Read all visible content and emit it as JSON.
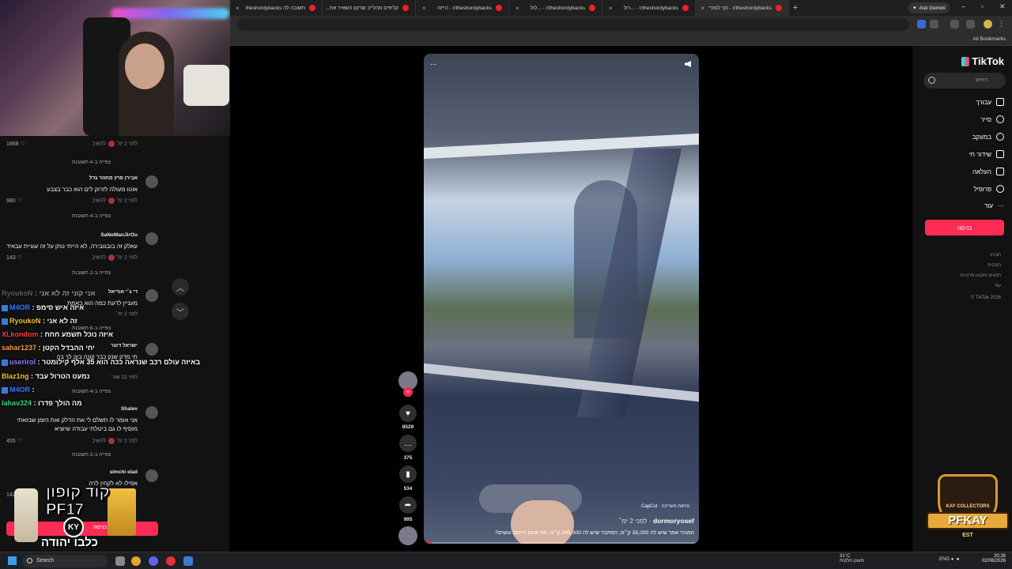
{
  "browser": {
    "tabs": [
      {
        "label": "תשובה לה theshordybacks"
      },
      {
        "label": "קליפים מהלייב שרקון השאיר את..."
      },
      {
        "label": "r/theshordybacks - הייזה"
      },
      {
        "label": "r/theshordybacks - ...לול"
      },
      {
        "label": "r/theshordybacks - ...רול"
      },
      {
        "label": "r/theshordybacks - נקי לנוזרי"
      }
    ],
    "new_tab": "+",
    "gemini_label": "Ask Gemini",
    "bookmarks_label": "All Bookmarks"
  },
  "comments": [
    {
      "author": "",
      "text": "",
      "meta": "לפני 2 ימ׳",
      "reply": "להשיב",
      "likes": "1868",
      "replies": "צפייה ב-4 תשובות"
    },
    {
      "author": "אבירן פרץ מחוזר גדל",
      "text": "אוטו מעולה לזרוק לים הוא כבר בצבע",
      "meta": "לפני 2 ימ׳",
      "reply": "להשיב",
      "likes": "980",
      "replies": "צפייה ב-4 תשובות"
    },
    {
      "author": "SaNoManJirOu",
      "text": "עאלק זה בובגובירה, לא הייתי נותן על זה עוגיית עבאיד",
      "meta": "לפני 2 ימ׳",
      "reply": "להשיב",
      "likes": "143",
      "replies": "צפייה ב-2 תשובות"
    },
    {
      "author": "די ג׳י אוריאל",
      "text": "מעניין לדעת כמה הוא באמת",
      "meta": "לפני 2 ימ׳",
      "reply": "להשיב",
      "likes": "1",
      "replies": "צפייה ב-6 תשובות"
    },
    {
      "author": "ישראל דזגר",
      "text": "תי מדק שנק כבר קונה בוק לך בה",
      "meta": "לפני 22 שע׳",
      "reply": "להשיב",
      "likes": "",
      "replies": "צפייה ב-4 תשובות"
    },
    {
      "author": "Shalev",
      "text": "אני אומר לו תשלם לי את הדלק ואת הזמן שבזאתי מוסיף לו גם ביטלתי עבודה שיוציא",
      "meta": "לפני 2 ימ׳",
      "reply": "להשיב",
      "likes": "455",
      "replies": "צפייה ב-2 תשובות"
    },
    {
      "author": "simchi elad",
      "text": "אפילו לא לקחין לרה",
      "meta": "",
      "reply": "",
      "likes": "142",
      "replies": ""
    }
  ],
  "chat": [
    {
      "user": "RyoukoN",
      "msg": "אני קוני זה לא אני",
      "color": "#7a7a7a"
    },
    {
      "user": "M4OR",
      "msg": "איזה איש סימפ",
      "color": "#3c78ff"
    },
    {
      "user": "RyoukoN",
      "msg": "זה לא אני",
      "color": "#f7c31e"
    },
    {
      "user": "XLkondom",
      "msg": "איזה נוכל תשמע חחח",
      "color": "#ff3b3b"
    },
    {
      "user": "sahar1237",
      "msg": "יחי ההבדל הקטן",
      "color": "#ff9a3c"
    },
    {
      "user": "userirol",
      "msg": "באיזה עולם רכב שנראה ככה הוא 35 אלף קילומטר",
      "color": "#9b7cff"
    },
    {
      "user": "Blaz1ng",
      "msg": "נמעט הטרול עבד",
      "color": "#f7c31e"
    },
    {
      "user": "M4OR",
      "msg": "",
      "color": "#3c78ff"
    },
    {
      "user": "lahav324",
      "msg": "מה הולך פדרו",
      "color": "#2ed47a"
    }
  ],
  "promo": {
    "code_line1": "קוד קופון",
    "code_line2": "PF17",
    "name": "כלבו יהודה",
    "badge": "KY",
    "bar": "כניסה"
  },
  "video": {
    "more": "...",
    "label": "CapCut · פיתוח העריכה",
    "author": "dormoryosef",
    "date": "· לפני 2 ימ׳",
    "caption": "המוכר אמר שיש לה 35,000 ק״מ, הסתבר שיש לה 345,000 ק״מ. מה אתם הייתם עושים?",
    "progress": 0.03
  },
  "actions": {
    "likes": "8529",
    "comments": "375",
    "saves": "534",
    "shares": "995"
  },
  "sidebar": {
    "logo": "TikTok",
    "search_placeholder": "חיפוש",
    "nav": [
      "עבורך",
      "סייר",
      "במעקב",
      "שידור חי",
      "העלאה",
      "פרופיל",
      "עוד"
    ],
    "login": "כניסה",
    "footer": [
      "חברה",
      "תוכנית",
      "תנאים ותקנון פרטיות",
      "עוד",
      "TikTok 2026 ©"
    ]
  },
  "overlay_logo": {
    "sub": "KAY COLLECTORS",
    "name": "PFKAY",
    "est": "EST"
  },
  "taskbar": {
    "search": "Search",
    "temp": "31°C",
    "weather": "מעונן חלקית",
    "lang": "ENG",
    "time": "20:26",
    "date": "02/08/2026"
  }
}
